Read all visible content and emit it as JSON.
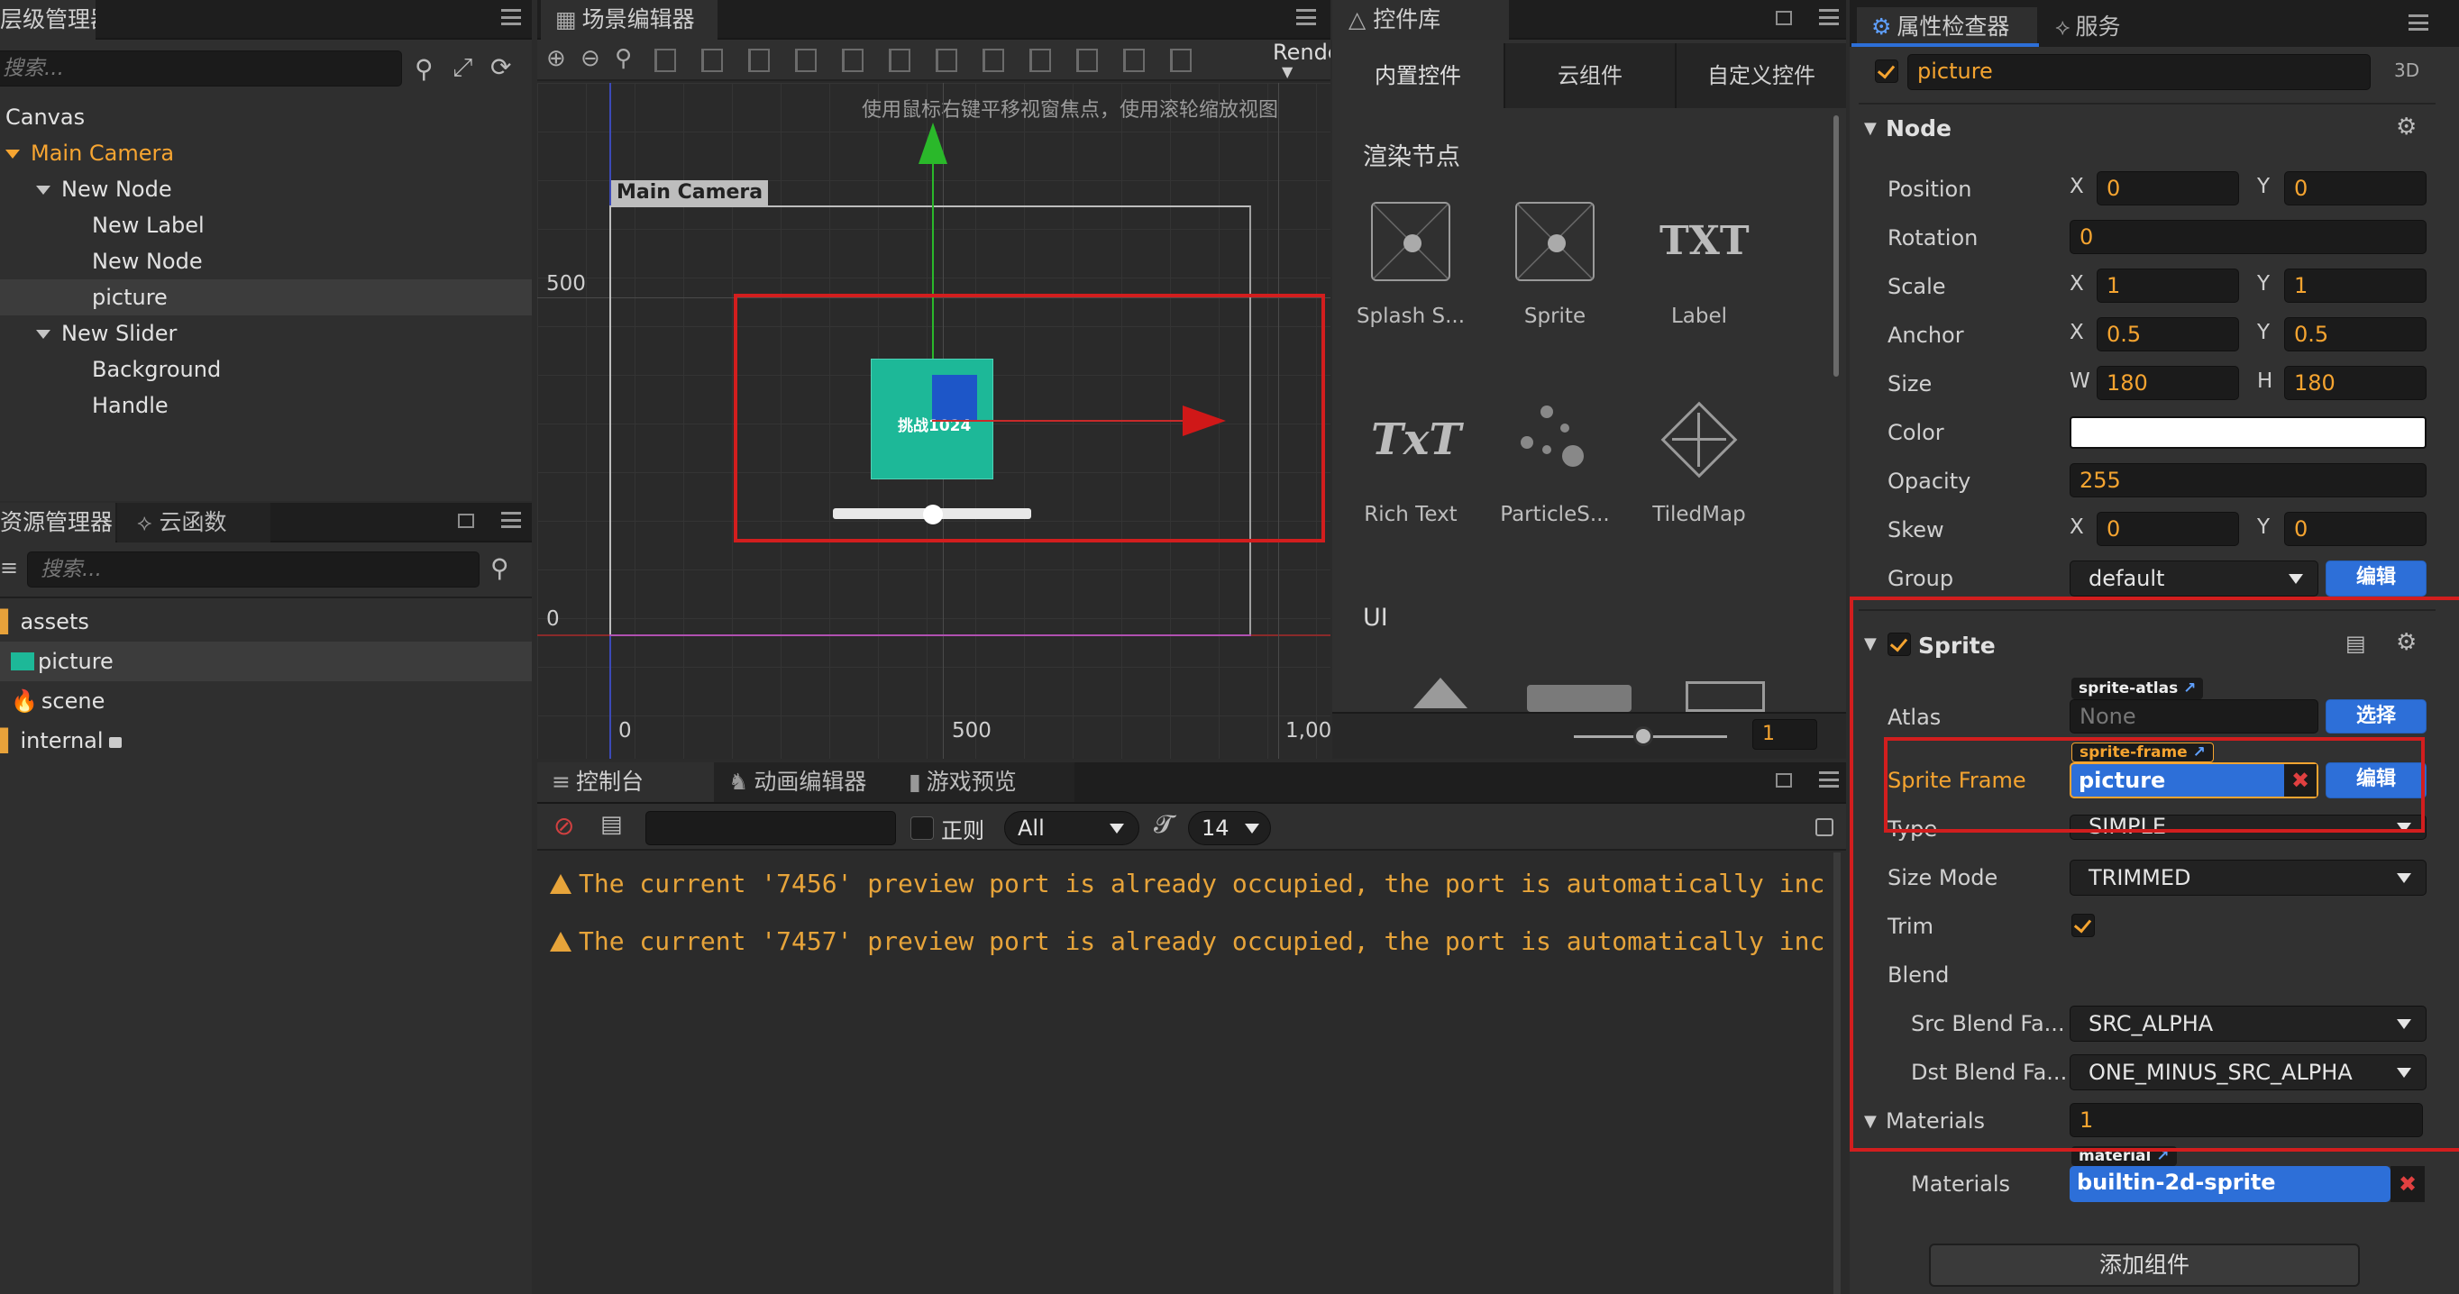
{
  "hierarchy": {
    "tab": "层级管理器",
    "search_placeholder": "搜索...",
    "nodes": [
      {
        "label": "Canvas",
        "level": 0,
        "expanded": false,
        "color": "#e2e2e2"
      },
      {
        "label": "Main Camera",
        "level": 0,
        "expanded": true,
        "color": "#f7a531"
      },
      {
        "label": "New Node",
        "level": 1,
        "expanded": true,
        "color": "#e2e2e2"
      },
      {
        "label": "New Label",
        "level": 2,
        "expanded": false,
        "color": "#e2e2e2"
      },
      {
        "label": "New Node",
        "level": 2,
        "expanded": false,
        "color": "#e2e2e2"
      },
      {
        "label": "picture",
        "level": 2,
        "expanded": false,
        "color": "#e2e2e2",
        "selected": true
      },
      {
        "label": "New Slider",
        "level": 1,
        "expanded": true,
        "color": "#e2e2e2"
      },
      {
        "label": "Background",
        "level": 2,
        "expanded": false,
        "color": "#e2e2e2"
      },
      {
        "label": "Handle",
        "level": 2,
        "expanded": false,
        "color": "#e2e2e2"
      }
    ]
  },
  "assets": {
    "tabs": [
      "资源管理器",
      "云函数"
    ],
    "search_placeholder": "搜索...",
    "items": [
      {
        "label": "assets",
        "icon": "folder-icon"
      },
      {
        "label": "picture",
        "icon": "image-icon",
        "selected": true
      },
      {
        "label": "scene",
        "icon": "fire-icon"
      },
      {
        "label": "internal",
        "icon": "lock-icon"
      }
    ]
  },
  "scene": {
    "tab": "场景编辑器",
    "render_label": "Rende",
    "hint": "使用鼠标右键平移视窗焦点，使用滚轮缩放视图",
    "camera_label": "Main Camera",
    "y_ticks": [
      "500",
      "0"
    ],
    "x_ticks": [
      "0",
      "500",
      "1,00"
    ],
    "sprite_text": "挑战1024"
  },
  "library": {
    "tab": "控件库",
    "subtabs": [
      "内置控件",
      "云组件",
      "自定义控件"
    ],
    "section1": "渲染节点",
    "items": [
      {
        "label": "Splash S...",
        "icon": "splash-icon"
      },
      {
        "label": "Sprite",
        "icon": "sprite-icon"
      },
      {
        "label": "Label",
        "icon": "label-icon",
        "glyph": "TXT"
      },
      {
        "label": "Rich Text",
        "icon": "richtext-icon",
        "glyph": "TxT"
      },
      {
        "label": "ParticleS...",
        "icon": "particle-icon"
      },
      {
        "label": "TiledMap",
        "icon": "tiledmap-icon"
      }
    ],
    "section2": "UI",
    "zoom_value": "1"
  },
  "console": {
    "tabs": [
      "控制台",
      "动画编辑器",
      "游戏预览"
    ],
    "regex_label": "正则",
    "filter_value": "All",
    "font_size": "14",
    "lines": [
      "The current '7456' preview port is already occupied, the port is automatically inc",
      "The current '7457' preview port is already occupied, the port is automatically inc"
    ]
  },
  "inspector": {
    "tabs": [
      "属性检查器",
      "服务"
    ],
    "node_name": "picture",
    "mode_3d": "3D",
    "node_section": "Node",
    "position": {
      "label": "Position",
      "x": "0",
      "y": "0"
    },
    "rotation": {
      "label": "Rotation",
      "value": "0"
    },
    "scale": {
      "label": "Scale",
      "x": "1",
      "y": "1"
    },
    "anchor": {
      "label": "Anchor",
      "x": "0.5",
      "y": "0.5"
    },
    "size": {
      "label": "Size",
      "w": "180",
      "h": "180"
    },
    "color": {
      "label": "Color",
      "value": "#ffffff"
    },
    "opacity": {
      "label": "Opacity",
      "value": "255"
    },
    "skew": {
      "label": "Skew",
      "x": "0",
      "y": "0"
    },
    "group": {
      "label": "Group",
      "value": "default",
      "edit": "编辑"
    },
    "axis_x": "X",
    "axis_y": "Y",
    "axis_w": "W",
    "axis_h": "H",
    "sprite_section": "Sprite",
    "atlas": {
      "label": "Atlas",
      "tag": "sprite-atlas",
      "value": "None",
      "button": "选择"
    },
    "sprite_frame": {
      "label": "Sprite Frame",
      "tag": "sprite-frame",
      "value": "picture",
      "button": "编辑"
    },
    "type": {
      "label": "Type",
      "value": "SIMPLE"
    },
    "size_mode": {
      "label": "Size Mode",
      "value": "TRIMMED"
    },
    "trim": {
      "label": "Trim"
    },
    "blend": {
      "label": "Blend"
    },
    "src_blend": {
      "label": "Src Blend Fa...",
      "value": "SRC_ALPHA"
    },
    "dst_blend": {
      "label": "Dst Blend Fa...",
      "value": "ONE_MINUS_SRC_ALPHA"
    },
    "materials_count": {
      "label": "Materials",
      "value": "1"
    },
    "materials_item": {
      "label": "Materials",
      "tag": "material",
      "value": "builtin-2d-sprite"
    },
    "add_component": "添加组件"
  },
  "colors": {
    "accent": "#f5a430",
    "highlight_red": "#d21e1e",
    "blue_button": "#2d6fd8",
    "sprite_teal": "#1db898"
  }
}
